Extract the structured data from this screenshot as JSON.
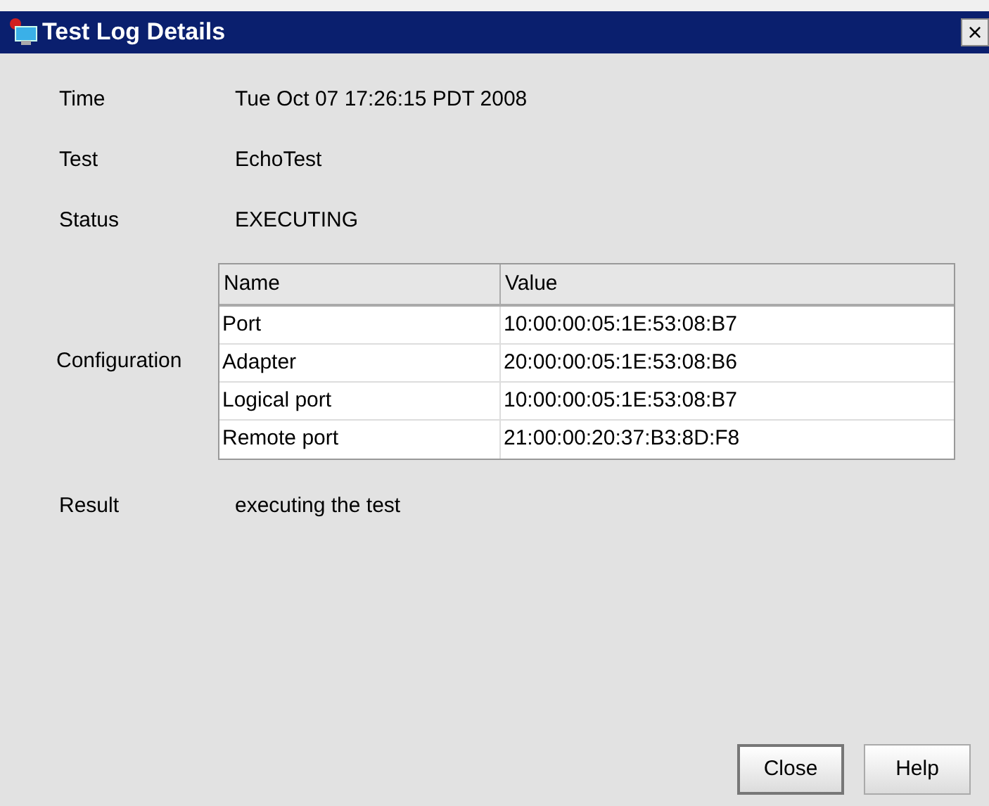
{
  "window": {
    "title": "Test Log Details",
    "close_glyph": "×"
  },
  "fields": [
    {
      "label": "Time",
      "value": "Tue Oct 07 17:26:15 PDT 2008"
    },
    {
      "label": "Test",
      "value": "EchoTest"
    },
    {
      "label": "Status",
      "value": "EXECUTING"
    }
  ],
  "configuration": {
    "label": "Configuration",
    "columns": [
      "Name",
      "Value"
    ],
    "rows": [
      [
        "Port",
        "10:00:00:05:1E:53:08:B7"
      ],
      [
        "Adapter",
        "20:00:00:05:1E:53:08:B6"
      ],
      [
        "Logical port",
        "10:00:00:05:1E:53:08:B7"
      ],
      [
        "Remote port",
        "21:00:00:20:37:B3:8D:F8"
      ]
    ]
  },
  "result": {
    "label": "Result",
    "value": "executing the test"
  },
  "buttons": [
    "Close",
    "Help"
  ]
}
